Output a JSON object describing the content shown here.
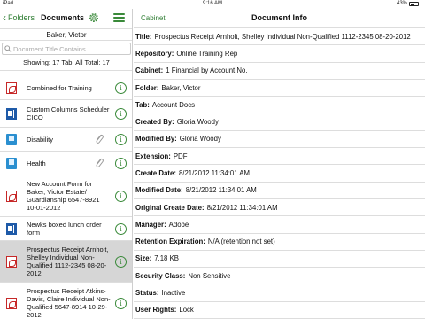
{
  "status_bar": {
    "device": "iPad",
    "time": "9:16 AM",
    "battery": "43%"
  },
  "left": {
    "back_label": "Folders",
    "title": "Documents",
    "user": "Baker, Victor",
    "search_placeholder": "Document Title Contains",
    "showing": "Showing: 17 Tab: All Total: 17",
    "docs": [
      {
        "label": "Combined for Training",
        "icon": "pdf-icon",
        "clip": false,
        "selected": false
      },
      {
        "label": "Custom Columns Scheduler CICO",
        "icon": "word-icon",
        "clip": false,
        "selected": false
      },
      {
        "label": "Disability",
        "icon": "book-icon",
        "clip": true,
        "selected": false
      },
      {
        "label": "Health",
        "icon": "book-icon",
        "clip": true,
        "selected": false
      },
      {
        "label": "New Account Form for Baker, Victor Estate/ Guardianship 6547-8921 10-01-2012",
        "icon": "pdf-icon",
        "clip": false,
        "selected": false
      },
      {
        "label": "Newks boxed lunch order form",
        "icon": "word-icon",
        "clip": false,
        "selected": false
      },
      {
        "label": "Prospectus Receipt Arnholt, Shelley Individual Non-Qualified 1112-2345 08-20-2012",
        "icon": "pdf-icon",
        "clip": false,
        "selected": true
      },
      {
        "label": "Prospectus Receipt Atkins-Davis, Claire Individual Non-Qualified 5647-8914 10-29-2012",
        "icon": "pdf-icon",
        "clip": false,
        "selected": false
      }
    ]
  },
  "right": {
    "back_label": "Cabinet",
    "title": "Document Info",
    "fields": [
      {
        "label": "Title:",
        "value": "Prospectus Receipt Arnholt, Shelley Individual Non-Qualified 1112-2345 08-20-2012"
      },
      {
        "label": "Repository:",
        "value": "Online Training Rep"
      },
      {
        "label": "Cabinet:",
        "value": "1 Financial by Account No."
      },
      {
        "label": "Folder:",
        "value": "Baker, Victor"
      },
      {
        "label": "Tab:",
        "value": "Account Docs"
      },
      {
        "label": "Created By:",
        "value": "Gloria Woody"
      },
      {
        "label": "Modified By:",
        "value": "Gloria Woody"
      },
      {
        "label": "Extension:",
        "value": "PDF"
      },
      {
        "label": "Create Date:",
        "value": "8/21/2012 11:34:01 AM"
      },
      {
        "label": "Modified Date:",
        "value": "8/21/2012 11:34:01 AM"
      },
      {
        "label": "Original Create Date:",
        "value": "8/21/2012 11:34:01 AM"
      },
      {
        "label": "Manager:",
        "value": "Adobe"
      },
      {
        "label": "Retention Expiration:",
        "value": "N/A (retention not set)"
      },
      {
        "label": "Size:",
        "value": "7.18 KB"
      },
      {
        "label": "Security Class:",
        "value": "Non Sensitive"
      },
      {
        "label": "Status:",
        "value": "Inactive"
      },
      {
        "label": "User Rights:",
        "value": "Lock"
      }
    ]
  },
  "colors": {
    "accent": "#2e7d32",
    "selected_row": "#d6d6d6",
    "pdf": "#c62828",
    "word": "#1e5aa8",
    "book": "#2a8fd0"
  }
}
